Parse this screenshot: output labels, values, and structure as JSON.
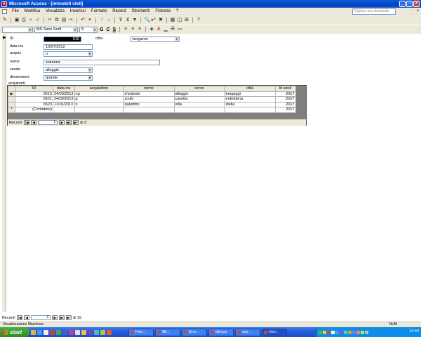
{
  "window": {
    "title": "Microsoft Access - [immobili visti]"
  },
  "menu": {
    "items": [
      "File",
      "Modifica",
      "Visualizza",
      "Inserisci",
      "Formato",
      "Record",
      "Strumenti",
      "Finestra",
      "?"
    ],
    "help_placeholder": "Digitare una domanda",
    "mdi_controls": [
      "-",
      "×"
    ]
  },
  "toolbar2": {
    "font_name": "MS Sans Serif",
    "font_size": "8",
    "bold": "G",
    "italic": "C",
    "underline": "S"
  },
  "form": {
    "fields": [
      {
        "label": "ID",
        "value": "515"
      },
      {
        "label": "citta",
        "value": "bergamo"
      },
      {
        "label": "data ins",
        "value": "10/07/2012"
      },
      {
        "label": "acquis",
        "value": "n"
      },
      {
        "label": "nome",
        "value": "susanna"
      },
      {
        "label": "vendo",
        "value": "alloggio"
      },
      {
        "label": "dimensione",
        "value": "grande"
      }
    ],
    "subform_label": "acquirenti"
  },
  "subform": {
    "columns": [
      "ID",
      "data ins",
      "acquisitore",
      "nome",
      "cerco",
      "città",
      "id vend"
    ],
    "rows": [
      {
        "marker": "▶",
        "cells": [
          "6515",
          "24/09/2013",
          "ng",
          "d'antonio",
          "alloggio",
          "bergaggi",
          "2017"
        ]
      },
      {
        "marker": "",
        "cells": [
          "6521",
          "24/09/2013",
          "g",
          "scolti",
          "casetta",
          "entrottena",
          "2017"
        ]
      },
      {
        "marker": "",
        "cells": [
          "6523",
          "11/10/2013",
          "n",
          "palumbo",
          "villa",
          "stella",
          "2017"
        ]
      },
      {
        "marker": "*",
        "cells": [
          "(Contatore)",
          "",
          "",
          "",
          "",
          "",
          "2017"
        ]
      }
    ],
    "nav": {
      "label": "Record:",
      "current": "1",
      "of_label": "di 3"
    }
  },
  "mainnav": {
    "label": "Record:",
    "current": "2",
    "of_label": "di 15"
  },
  "statusbar": {
    "text": "Visualizzazione Maschera",
    "num": "NUM"
  },
  "taskbar": {
    "start_label": "start",
    "tasks": [
      "Fato...",
      "Mil...",
      "Scrv...",
      "ditenza",
      "ava...",
      "Imm..."
    ],
    "clock": "14:43"
  },
  "colors": {
    "titlebar": "#0842b8",
    "start": "#2f8a2a",
    "taskbar": "#245edc",
    "chrome": "#ece9d8"
  }
}
